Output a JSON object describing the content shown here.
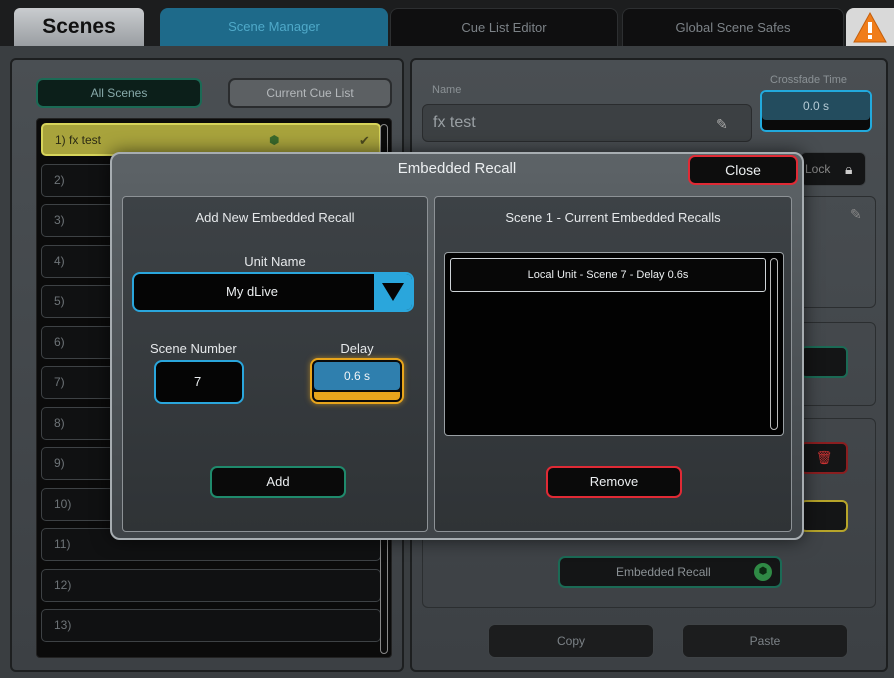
{
  "header": {
    "title": "Scenes",
    "tabs": [
      {
        "label": "Scene Manager",
        "active": true
      },
      {
        "label": "Cue List Editor",
        "active": false
      },
      {
        "label": "Global Scene Safes",
        "active": false
      }
    ],
    "warning_icon": "warning-icon"
  },
  "left": {
    "all_scenes_label": "All Scenes",
    "current_cue_label": "Current Cue List",
    "scenes": [
      {
        "label": "1) fx test",
        "active": true
      },
      {
        "label": "2)"
      },
      {
        "label": "3)"
      },
      {
        "label": "4)"
      },
      {
        "label": "5)"
      },
      {
        "label": "6)"
      },
      {
        "label": "7)"
      },
      {
        "label": "8)"
      },
      {
        "label": "9)"
      },
      {
        "label": "10)"
      },
      {
        "label": "11)"
      },
      {
        "label": "12)"
      },
      {
        "label": "13)"
      }
    ]
  },
  "right": {
    "name_label": "Name",
    "name_value": "fx test",
    "crossfade_label": "Crossfade Time",
    "crossfade_value": "0.0 s",
    "lock_label": "Lock",
    "embedded_recall_label": "Embedded Recall",
    "copy_label": "Copy",
    "paste_label": "Paste"
  },
  "modal": {
    "title": "Embedded Recall",
    "close_label": "Close",
    "add_section": {
      "heading": "Add New Embedded Recall",
      "unit_name_label": "Unit Name",
      "unit_name_value": "My dLive",
      "scene_number_label": "Scene Number",
      "scene_number_value": "7",
      "delay_label": "Delay",
      "delay_value": "0.6 s",
      "add_label": "Add"
    },
    "recalls_section": {
      "heading": "Scene 1 - Current Embedded Recalls",
      "items": [
        "Local Unit - Scene 7 - Delay 0.6s"
      ],
      "remove_label": "Remove"
    }
  },
  "colors": {
    "accent_blue": "#2aa6dc",
    "accent_green": "#1f8a6c",
    "accent_red": "#e02a35",
    "accent_orange": "#e8a51c",
    "active_scene": "#a8a33c"
  }
}
